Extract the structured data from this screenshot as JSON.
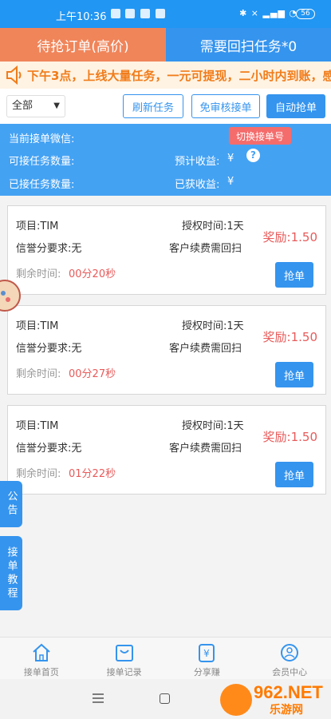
{
  "status_bar": {
    "time": "上午10:36",
    "battery": "56"
  },
  "top_tabs": [
    {
      "label": "待抢订单(高价)"
    },
    {
      "label": "需要回扫任务*0"
    }
  ],
  "announcement": "下午3点，上线大量任务，一元可提现，二小时内到账，感",
  "toolbar": {
    "filter_value": "全部",
    "refresh_label": "刷新任务",
    "free_review_label": "免审核接单",
    "auto_grab_label": "自动抢单"
  },
  "info": {
    "wechat_label": "当前接单微信:",
    "switch_label": "切换接单号",
    "available_label": "可接任务数量:",
    "expected_income_label": "预计收益:",
    "expected_income_value": "¥",
    "accepted_label": "已接任务数量:",
    "earned_label": "已获收益:",
    "earned_value": "¥"
  },
  "tasks": [
    {
      "project": "项目:TIM",
      "auth_time": "授权时间:1天",
      "credit": "信誉分要求:无",
      "note": "客户续费需回扫",
      "reward": "奖励:1.50",
      "remain_label": "剩余时间:",
      "countdown": "00分20秒",
      "button": "抢单"
    },
    {
      "project": "项目:TIM",
      "auth_time": "授权时间:1天",
      "credit": "信誉分要求:无",
      "note": "客户续费需回扫",
      "reward": "奖励:1.50",
      "remain_label": "剩余时间:",
      "countdown": "00分27秒",
      "button": "抢单"
    },
    {
      "project": "项目:TIM",
      "auth_time": "授权时间:1天",
      "credit": "信誉分要求:无",
      "note": "客户续费需回扫",
      "reward": "奖励:1.50",
      "remain_label": "剩余时间:",
      "countdown": "01分22秒",
      "button": "抢单"
    }
  ],
  "side_tabs": [
    {
      "label": "公告"
    },
    {
      "label": "接单教程"
    }
  ],
  "bottom_nav": [
    {
      "label": "接单首页",
      "icon": "home-icon"
    },
    {
      "label": "接单记录",
      "icon": "bag-icon"
    },
    {
      "label": "分享赚",
      "icon": "yen-icon"
    },
    {
      "label": "会员中心",
      "icon": "user-icon"
    }
  ],
  "watermark": {
    "brand": "962.NET",
    "sub": "乐游网"
  },
  "colors": {
    "primary": "#3594ee",
    "orange": "#f0855a",
    "accent_red": "#e85a5a"
  }
}
